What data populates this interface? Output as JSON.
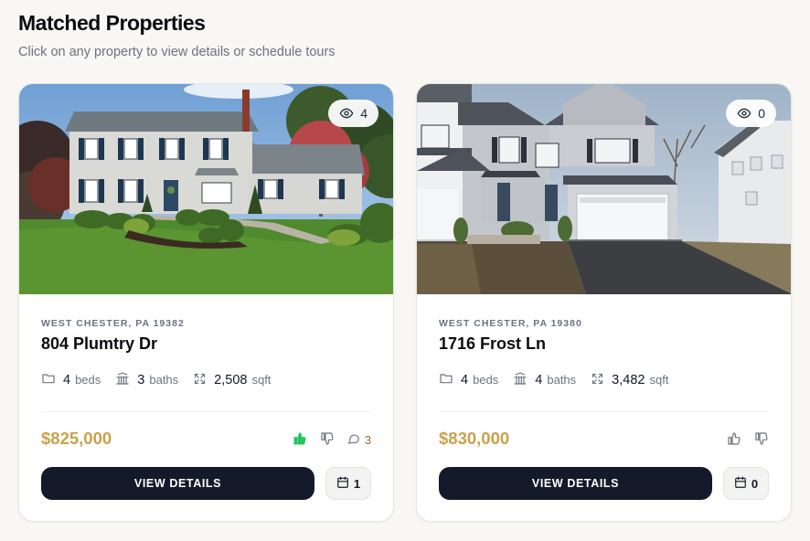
{
  "header": {
    "title": "Matched Properties",
    "subtitle": "Click on any property to view details or schedule tours"
  },
  "properties": [
    {
      "location": "WEST CHESTER, PA 19382",
      "address": "804 Plumtry Dr",
      "views": "4",
      "beds": "4",
      "beds_label": "beds",
      "baths": "3",
      "baths_label": "baths",
      "sqft": "2,508",
      "sqft_label": "sqft",
      "price": "$825,000",
      "liked": true,
      "comments": "3",
      "view_details_label": "VIEW DETAILS",
      "tours": "1"
    },
    {
      "location": "WEST CHESTER, PA 19380",
      "address": "1716 Frost Ln",
      "views": "0",
      "beds": "4",
      "beds_label": "beds",
      "baths": "4",
      "baths_label": "baths",
      "sqft": "3,482",
      "sqft_label": "sqft",
      "price": "$830,000",
      "liked": false,
      "comments": null,
      "view_details_label": "VIEW DETAILS",
      "tours": "0"
    }
  ],
  "icons": {
    "views": "eye-icon",
    "beds": "bed-icon",
    "baths": "bath-icon",
    "sqft": "expand-icon",
    "like": "thumbs-up-icon",
    "dislike": "thumbs-down-icon",
    "comments": "comment-icon",
    "tours": "calendar-icon"
  },
  "colors": {
    "price": "#c9a24a",
    "primary_button": "#141a2a",
    "like_active": "#22c55e",
    "background": "#f8f7f4"
  }
}
